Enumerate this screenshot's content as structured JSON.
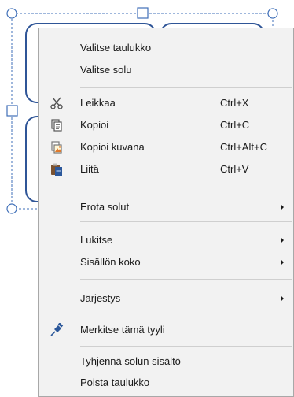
{
  "menu": {
    "groups": [
      {
        "items": [
          {
            "label": "Valitse taulukko"
          },
          {
            "label": "Valitse solu"
          }
        ]
      },
      {
        "items": [
          {
            "label": "Leikkaa",
            "shortcut": "Ctrl+X",
            "icon": "scissors-icon"
          },
          {
            "label": "Kopioi",
            "shortcut": "Ctrl+C",
            "icon": "copy-icon"
          },
          {
            "label": "Kopioi kuvana",
            "shortcut": "Ctrl+Alt+C",
            "icon": "copy-as-picture-icon"
          },
          {
            "label": "Liitä",
            "shortcut": "Ctrl+V",
            "icon": "paste-icon"
          }
        ]
      },
      {
        "items": [
          {
            "label": "Erota solut",
            "submenu": true
          }
        ]
      },
      {
        "items": [
          {
            "label": "Lukitse",
            "submenu": true
          },
          {
            "label": "Sisällön koko",
            "submenu": true
          }
        ]
      },
      {
        "items": [
          {
            "label": "Järjestys",
            "submenu": true
          }
        ]
      },
      {
        "items": [
          {
            "label": "Merkitse tämä tyyli",
            "icon": "pin-icon"
          }
        ]
      },
      {
        "items": [
          {
            "label": "Tyhjennä solun sisältö"
          },
          {
            "label": "Poista taulukko"
          }
        ]
      }
    ]
  },
  "colors": {
    "selection_dashed": "#3f6fb8",
    "shape_outline": "#2f5597",
    "menu_bg": "#f2f2f2",
    "menu_border": "#a8a8a8",
    "separator": "#cfcfcf",
    "pin_blue": "#2b579a"
  }
}
